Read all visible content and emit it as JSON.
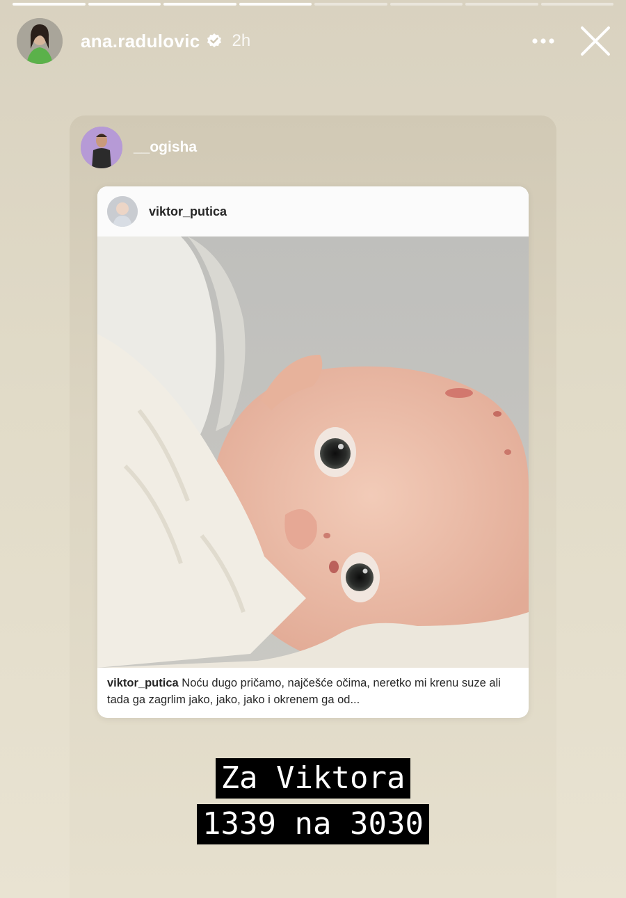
{
  "story": {
    "progress_segments": 8,
    "progress_completed": 4
  },
  "header": {
    "username": "ana.radulovic",
    "verified": true,
    "time": "2h",
    "more_icon": "more-horizontal-icon",
    "close_icon": "close-icon"
  },
  "reshare": {
    "username": "__ogisha"
  },
  "post": {
    "username": "viktor_putica",
    "caption_user": "viktor_putica",
    "caption_text": " Noću dugo pričamo, najčešće očima, neretko mi krenu suze ali tada ga zagrlim jako, jako, jako i okrenem ga od..."
  },
  "overlay": {
    "line1": "Za Viktora",
    "line2": "1339 na 3030"
  },
  "colors": {
    "background": "#e1dbc8",
    "overlay_bg": "#000000",
    "overlay_text": "#ffffff"
  }
}
